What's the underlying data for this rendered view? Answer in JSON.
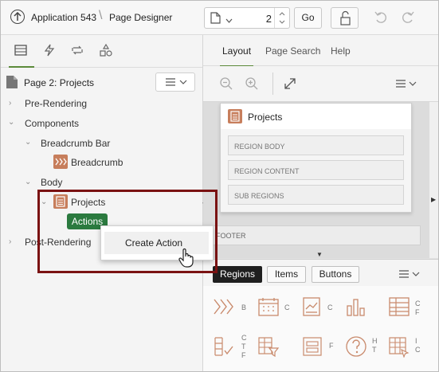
{
  "header": {
    "app_name": "Application 543",
    "page_name": "Page Designer",
    "page_number": "2",
    "go_label": "Go"
  },
  "left_panel": {
    "tabs": [
      "rendering-tab",
      "dynamic-actions-tab",
      "processing-tab",
      "shared-components-tab"
    ],
    "page_title": "Page 2: Projects",
    "tree": {
      "pre_rendering": "Pre-Rendering",
      "components": "Components",
      "breadcrumb_bar": "Breadcrumb Bar",
      "breadcrumb": "Breadcrumb",
      "body": "Body",
      "projects": "Projects",
      "actions": "Actions",
      "post_rendering": "Post-Rendering"
    }
  },
  "context_menu": {
    "create_action": "Create Action"
  },
  "right_panel": {
    "tabs": {
      "layout": "Layout",
      "page_search": "Page Search",
      "help": "Help"
    },
    "region": {
      "title": "Projects",
      "slots": [
        "REGION BODY",
        "REGION CONTENT",
        "SUB REGIONS"
      ],
      "footer": "FOOTER"
    },
    "gallery_tabs": {
      "regions": "Regions",
      "items": "Items",
      "buttons": "Buttons"
    },
    "gallery_labels": {
      "g1": "B",
      "g2": "C",
      "g3": "C",
      "g5": "C F",
      "g6": "C T F",
      "g8": "F",
      "g9": "H T",
      "g10": "I C"
    }
  },
  "colors": {
    "accent_green": "#2b7a3f",
    "component_icon": "#c77e5c",
    "highlight_border": "#7a1212"
  }
}
